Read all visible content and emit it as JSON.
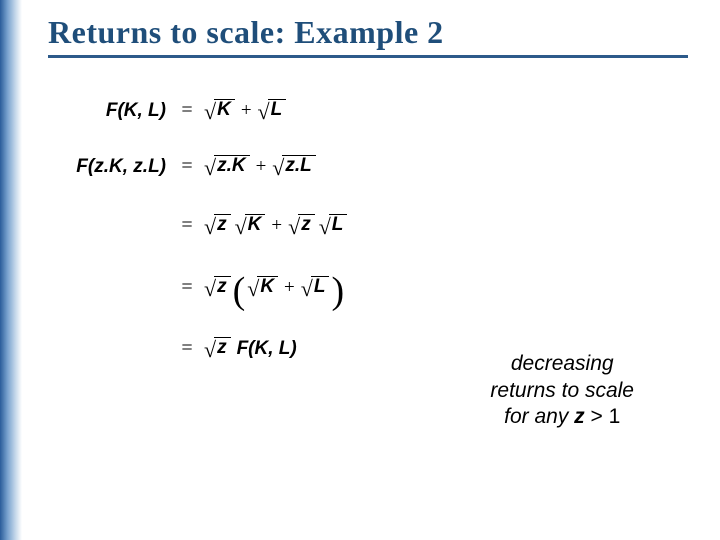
{
  "title": "Returns to scale:  Example 2",
  "math": {
    "row1": {
      "lhs": "F(K, L)",
      "rhs_a": "K",
      "rhs_b": "L"
    },
    "row2": {
      "lhs": "F(z.K, z.L)",
      "rhs_a": "z.K",
      "rhs_b": "z.L"
    },
    "row3": {
      "z1": "z",
      "a": "K",
      "z2": "z",
      "b": "L"
    },
    "row4": {
      "z": "z",
      "a": "K",
      "b": "L"
    },
    "row5": {
      "z": "z",
      "F": "F(K, L)"
    },
    "plus": "+",
    "eq": "="
  },
  "conclusion": {
    "line1": "decreasing",
    "line2": "returns to scale",
    "line3_prefix": "for any ",
    "line3_z": "z",
    "line3_gt": " > 1"
  }
}
